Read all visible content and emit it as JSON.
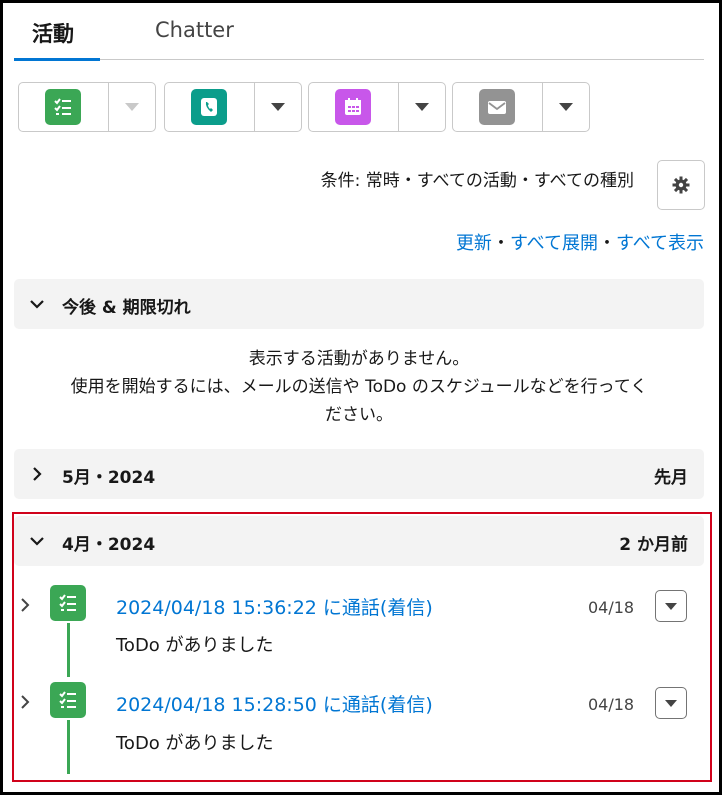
{
  "tabs": [
    {
      "label": "活動",
      "active": true
    },
    {
      "label": "Chatter",
      "active": false
    }
  ],
  "actions": [
    {
      "icon": "task-icon",
      "color": "#3ba755",
      "arrow_disabled": true
    },
    {
      "icon": "call-icon",
      "color": "#0b9d8b",
      "arrow_disabled": false
    },
    {
      "icon": "calendar-icon",
      "color": "#c857ea",
      "arrow_disabled": false
    },
    {
      "icon": "email-icon",
      "color": "#939393",
      "arrow_disabled": false
    }
  ],
  "filter": {
    "text": "条件: 常時・すべての活動・すべての種別"
  },
  "links": {
    "refresh": "更新",
    "expand_all": "すべて展開",
    "view_all": "すべて表示",
    "separator": "・"
  },
  "sections": {
    "upcoming": {
      "title": "今後 & 期限切れ"
    },
    "empty_message": {
      "line1": "表示する活動がありません。",
      "line2": "使用を開始するには、メールの送信や ToDo のスケジュールなどを行ってく",
      "line3": "ださい。"
    },
    "may": {
      "title": "5月・2024",
      "right": "先月"
    },
    "april": {
      "title": "4月・2024",
      "right": "2 か月前"
    }
  },
  "items": [
    {
      "title": "2024/04/18 15:36:22 に通話(着信)",
      "desc": "ToDo がありました",
      "date": "04/18"
    },
    {
      "title": "2024/04/18 15:28:50 に通話(着信)",
      "desc": "ToDo がありました",
      "date": "04/18"
    }
  ],
  "colors": {
    "accent": "#0176d3",
    "task_green": "#3ba755",
    "highlight_red": "#d0021b"
  }
}
